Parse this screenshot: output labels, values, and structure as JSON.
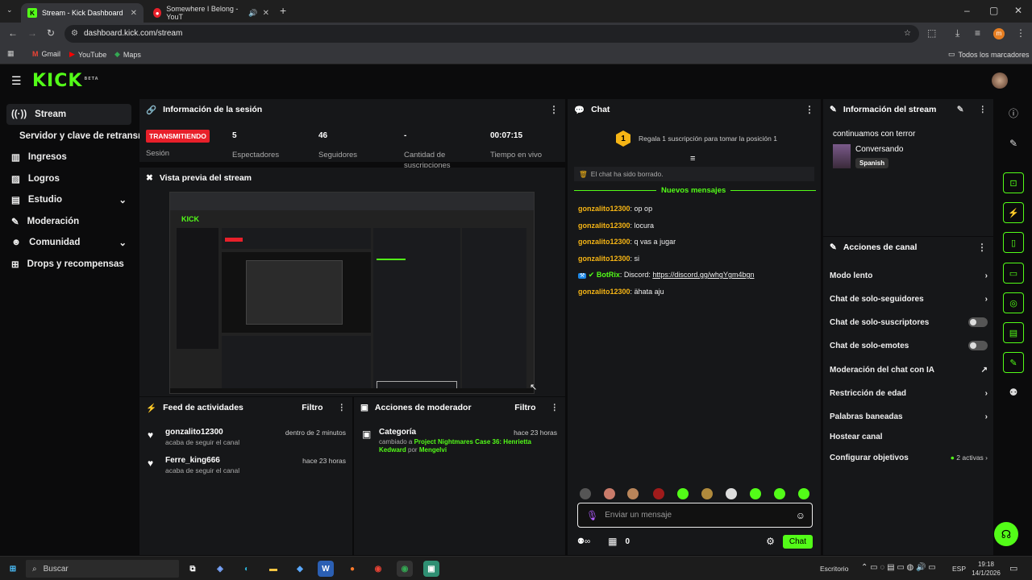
{
  "browser": {
    "tabs": [
      {
        "title": "Stream - Kick Dashboard",
        "active": true
      },
      {
        "title": "Somewhere I Belong - YouT",
        "active": false
      }
    ],
    "url": "dashboard.kick.com/stream",
    "bookmarks": [
      "Gmail",
      "YouTube",
      "Maps"
    ],
    "all_bookmarks": "Todos los marcadores"
  },
  "app": {
    "logo": "KICK",
    "logo_sup": "BETA"
  },
  "sidebar": {
    "items": [
      {
        "label": "Stream",
        "icon": "broadcast-icon"
      },
      {
        "label": "Servidor y clave de retransmisión",
        "icon": ""
      },
      {
        "label": "Ingresos",
        "icon": "revenue-icon"
      },
      {
        "label": "Logros",
        "icon": "trophy-icon"
      },
      {
        "label": "Estudio",
        "icon": "studio-icon"
      },
      {
        "label": "Moderación",
        "icon": "wrench-icon"
      },
      {
        "label": "Comunidad",
        "icon": "community-icon"
      },
      {
        "label": "Drops y recompensas",
        "icon": "drops-icon"
      }
    ]
  },
  "session": {
    "title": "Información de la sesión",
    "live_badge": "TRANSMITIENDO",
    "session_label": "Sesión",
    "stats": [
      {
        "value": "5",
        "label": "Espectadores"
      },
      {
        "value": "46",
        "label": "Seguidores"
      },
      {
        "value": "-",
        "label": "Cantidad de suscripciones"
      },
      {
        "value": "00:07:15",
        "label": "Tiempo en vivo"
      }
    ]
  },
  "preview": {
    "title": "Vista previa del stream"
  },
  "activity": {
    "title": "Feed de actividades",
    "filter": "Filtro",
    "items": [
      {
        "user": "gonzalito12300",
        "text": "acaba de seguir el canal",
        "time": "dentro de 2 minutos"
      },
      {
        "user": "Ferre_king666",
        "text": "acaba de seguir el canal",
        "time": "hace 23 horas"
      }
    ]
  },
  "modactions": {
    "title": "Acciones de moderador",
    "filter": "Filtro",
    "item": {
      "title": "Categoría",
      "time": "hace 23 horas",
      "prefix": "cambiado a",
      "value": "Project Nightmares Case 36: Henrietta Kedward",
      "by": "por",
      "mod": "Mengelvi"
    }
  },
  "chat": {
    "title": "Chat",
    "gift_rank": "1",
    "gift_text": "Regala 1 suscripción para tomar la posición 1",
    "cleared": "El chat ha sido borrado.",
    "new_messages": "Nuevos mensajes",
    "messages": [
      {
        "user": "gonzalito12300",
        "text": "op op"
      },
      {
        "user": "gonzalito12300",
        "text": "locura"
      },
      {
        "user": "gonzalito12300",
        "text": "q vas a jugar"
      },
      {
        "user": "gonzalito12300",
        "text": "si"
      },
      {
        "user": "BotRix",
        "text": "Discord: ",
        "link": "https://discord.gg/whgYgm4bgn"
      },
      {
        "user": "gonzalito12300",
        "text": "ähata aju"
      }
    ],
    "placeholder": "Enviar un mensaje",
    "points": "0",
    "send": "Chat"
  },
  "streaminfo": {
    "title": "Información del stream",
    "stream_title": "continuamos con terror",
    "category": "Conversando",
    "language": "Spanish"
  },
  "channel": {
    "title": "Acciones de canal",
    "actions": [
      {
        "label": "Modo lento",
        "control": "chevron"
      },
      {
        "label": "Chat de solo-seguidores",
        "control": "chevron"
      },
      {
        "label": "Chat de solo-suscriptores",
        "control": "toggle"
      },
      {
        "label": "Chat de solo-emotes",
        "control": "toggle"
      },
      {
        "label": "Moderación del chat con IA",
        "control": "external"
      },
      {
        "label": "Restricción de edad",
        "control": "chevron"
      },
      {
        "label": "Palabras baneadas",
        "control": "chevron"
      },
      {
        "label": "Hostear canal",
        "control": "none"
      },
      {
        "label": "Configurar objetivos",
        "control": "chevron",
        "extra": "2 activas"
      }
    ]
  },
  "taskbar": {
    "search": "Buscar",
    "desktop": "Escritorio",
    "lang": "ESP",
    "time": "19:18",
    "date": "14/1/2026"
  },
  "colors": {
    "accent": "#53fc18",
    "live": "#e8202a",
    "username": "#f6b515"
  }
}
